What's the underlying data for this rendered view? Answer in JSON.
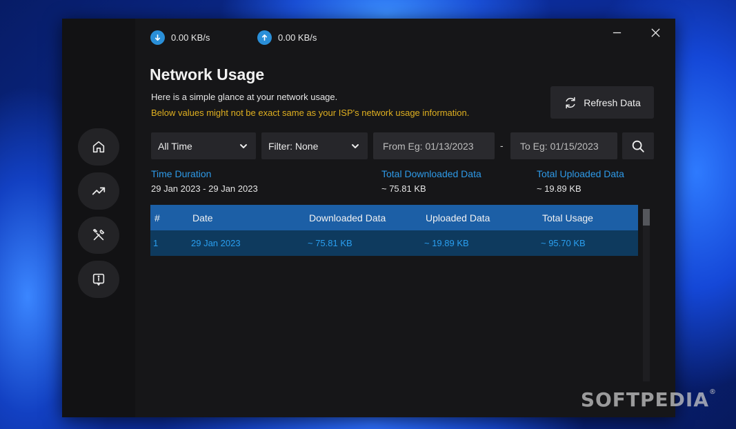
{
  "speed": {
    "download": "0.00 KB/s",
    "upload": "0.00 KB/s"
  },
  "page": {
    "title": "Network Usage",
    "subtitle": "Here is a simple glance at your network usage.",
    "warning": "Below values might not be exact same as your ISP's network usage information."
  },
  "toolbar": {
    "refresh_label": "Refresh Data",
    "range_selected": "All Time",
    "filter_selected": "Filter: None",
    "from_placeholder": "From Eg: 01/13/2023",
    "to_placeholder": "To Eg: 01/15/2023",
    "separator": "-"
  },
  "summary": {
    "duration_label": "Time Duration",
    "duration_value": "29 Jan 2023 - 29 Jan 2023",
    "downloaded_label": "Total Downloaded Data",
    "downloaded_value": "~ 75.81 KB",
    "uploaded_label": "Total Uploaded Data",
    "uploaded_value": "~ 19.89 KB"
  },
  "table": {
    "headers": [
      "#",
      "Date",
      "Downloaded Data",
      "Uploaded Data",
      "Total Usage"
    ],
    "rows": [
      [
        "1",
        "29 Jan 2023",
        "~ 75.81 KB",
        "~ 19.89 KB",
        "~ 95.70 KB"
      ]
    ]
  },
  "sidebar": {
    "items": [
      {
        "icon": "home-icon"
      },
      {
        "icon": "trend-icon"
      },
      {
        "icon": "tools-icon"
      },
      {
        "icon": "info-icon"
      }
    ]
  },
  "watermark": "SOFTPEDIA",
  "colors": {
    "accent": "#2e9ae8",
    "warning": "#e0b020",
    "table_header": "#1c5fa6",
    "table_row_selected": "#0e3a5e"
  }
}
